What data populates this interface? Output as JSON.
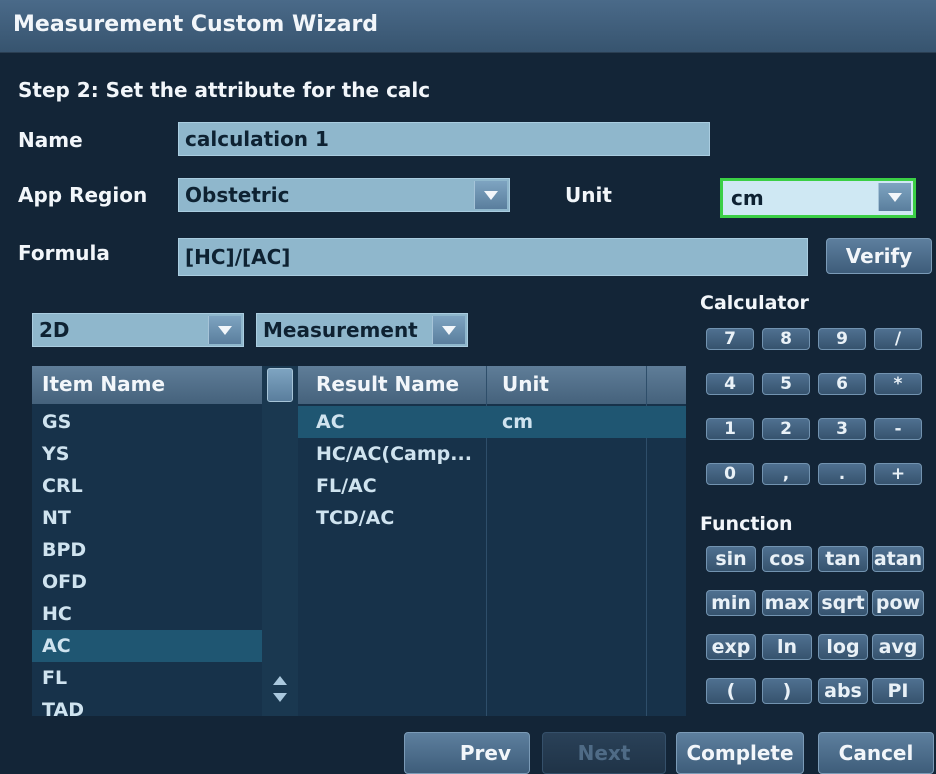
{
  "window": {
    "title": "Measurement Custom Wizard"
  },
  "step": {
    "text": "Step 2: Set the attribute for the calc"
  },
  "name": {
    "label": "Name",
    "value": "calculation 1"
  },
  "app_region": {
    "label": "App Region",
    "value": "Obstetric"
  },
  "unit": {
    "label": "Unit",
    "value": "cm"
  },
  "formula": {
    "label": "Formula",
    "value": "[HC]/[AC]",
    "verify_label": "Verify"
  },
  "filters": {
    "mode": "2D",
    "type": "Measurement"
  },
  "item_list": {
    "header": "Item Name",
    "items": [
      "GS",
      "YS",
      "CRL",
      "NT",
      "BPD",
      "OFD",
      "HC",
      "AC",
      "FL",
      "TAD"
    ],
    "selected_index": 7
  },
  "result_table": {
    "headers": [
      "Result Name",
      "Unit"
    ],
    "rows": [
      {
        "name": "AC",
        "unit": "cm"
      },
      {
        "name": "HC/AC(Camp...",
        "unit": ""
      },
      {
        "name": "FL/AC",
        "unit": ""
      },
      {
        "name": "TCD/AC",
        "unit": ""
      }
    ],
    "selected_index": 0
  },
  "calculator": {
    "label": "Calculator",
    "keys": [
      "7",
      "8",
      "9",
      "/",
      "4",
      "5",
      "6",
      "*",
      "1",
      "2",
      "3",
      "-",
      "0",
      ",",
      ".",
      "+"
    ]
  },
  "function": {
    "label": "Function",
    "keys": [
      "sin",
      "cos",
      "tan",
      "atan",
      "min",
      "max",
      "sqrt",
      "pow",
      "exp",
      "ln",
      "log",
      "avg",
      "(",
      ")",
      "abs",
      "PI"
    ]
  },
  "footer": {
    "prev": "Prev",
    "next": "Next",
    "complete": "Complete",
    "cancel": "Cancel"
  },
  "colors": {
    "accent_focus": "#3bcf45",
    "selection": "#1f5672",
    "title_bar": "#4a6a89"
  }
}
